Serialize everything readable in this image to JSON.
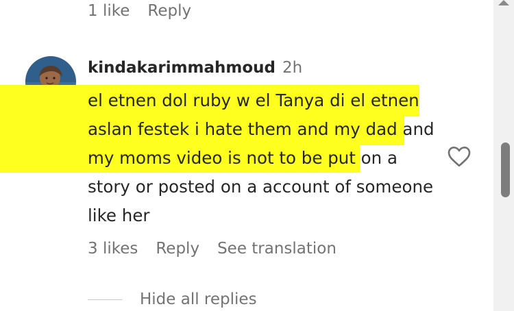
{
  "previous_comment": {
    "likes": "1 like",
    "reply": "Reply"
  },
  "comment": {
    "username": "kindakarimmahmoud",
    "time": "2h",
    "text": "el etnen dol ruby w el Tanya di el etnen aslan festek i hate them and my dad and my moms video is not to be put on a story or posted on a account of someone like her",
    "likes": "3 likes",
    "reply": "Reply",
    "translate": "See translation",
    "hide_replies": "Hide all replies"
  },
  "icons": {
    "like": "heart-outline-icon",
    "avatar": "user-avatar"
  },
  "colors": {
    "highlight": "#ffff1f",
    "text": "#262626",
    "secondary_text": "#737373",
    "scroll_thumb": "#7d7d7d"
  }
}
